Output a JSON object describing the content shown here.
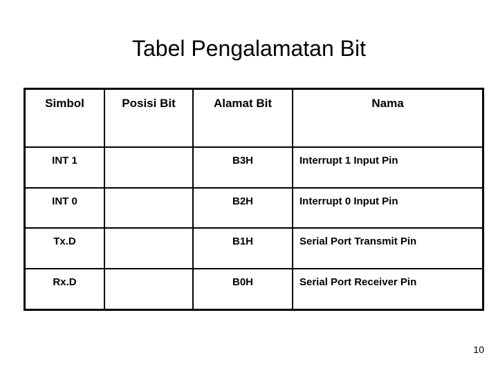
{
  "slide": {
    "title": "Tabel Pengalamatan Bit",
    "page_number": "10",
    "background_color": "#ffffff",
    "text_color": "#000000",
    "border_color": "#000000"
  },
  "table": {
    "headers": [
      "Simbol",
      "Posisi Bit",
      "Alamat Bit",
      "Nama"
    ],
    "rows": [
      {
        "simbol": "INT 1",
        "posisi_bit": "",
        "alamat_bit": "B3H",
        "nama": "Interrupt 1 Input Pin"
      },
      {
        "simbol": "INT 0",
        "posisi_bit": "",
        "alamat_bit": "B2H",
        "nama": "Interrupt 0 Input Pin"
      },
      {
        "simbol": "Tx.D",
        "posisi_bit": "",
        "alamat_bit": "B1H",
        "nama": "Serial Port Transmit Pin"
      },
      {
        "simbol": "Rx.D",
        "posisi_bit": "",
        "alamat_bit": "B0H",
        "nama": "Serial Port Receiver Pin"
      }
    ]
  }
}
